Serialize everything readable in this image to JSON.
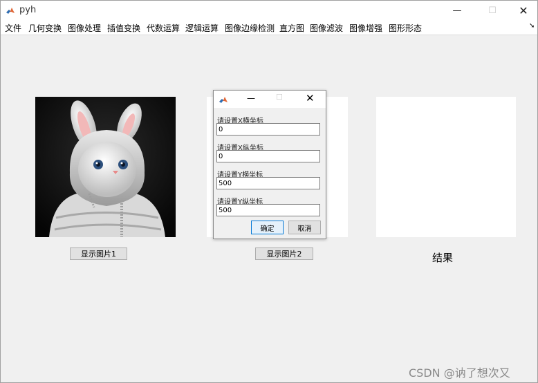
{
  "window": {
    "title": "pyh"
  },
  "window_controls": {
    "minimize": "—",
    "maximize": "☐",
    "close": "✕"
  },
  "menubar": {
    "items": [
      "文件",
      "几何变换",
      "图像处理",
      "插值变换",
      "代数运算",
      "逻辑运算",
      "图像边缘检测",
      "直方图",
      "图像滤波",
      "图像增强",
      "图形形态"
    ],
    "overflow_arrow": "➘"
  },
  "buttons": {
    "show_image_1": "显示图片1",
    "show_image_2": "显示图片2"
  },
  "result_label": "结果",
  "watermark": "CSDN @讷了想次又",
  "dialog": {
    "controls": {
      "minimize": "—",
      "maximize": "☐",
      "close": "✕"
    },
    "fields": [
      {
        "label": "请设置X横坐标",
        "value": "0"
      },
      {
        "label": "请设置X纵坐标",
        "value": "0"
      },
      {
        "label": "请设置Y横坐标",
        "value": "500"
      },
      {
        "label": "请设置Y纵坐标",
        "value": "500"
      }
    ],
    "ok": "确定",
    "cancel": "取消"
  },
  "colors": {
    "background": "#f0f0f0",
    "ok_border": "#0078d7"
  },
  "icons": {
    "app": "matlab-logo-icon"
  }
}
